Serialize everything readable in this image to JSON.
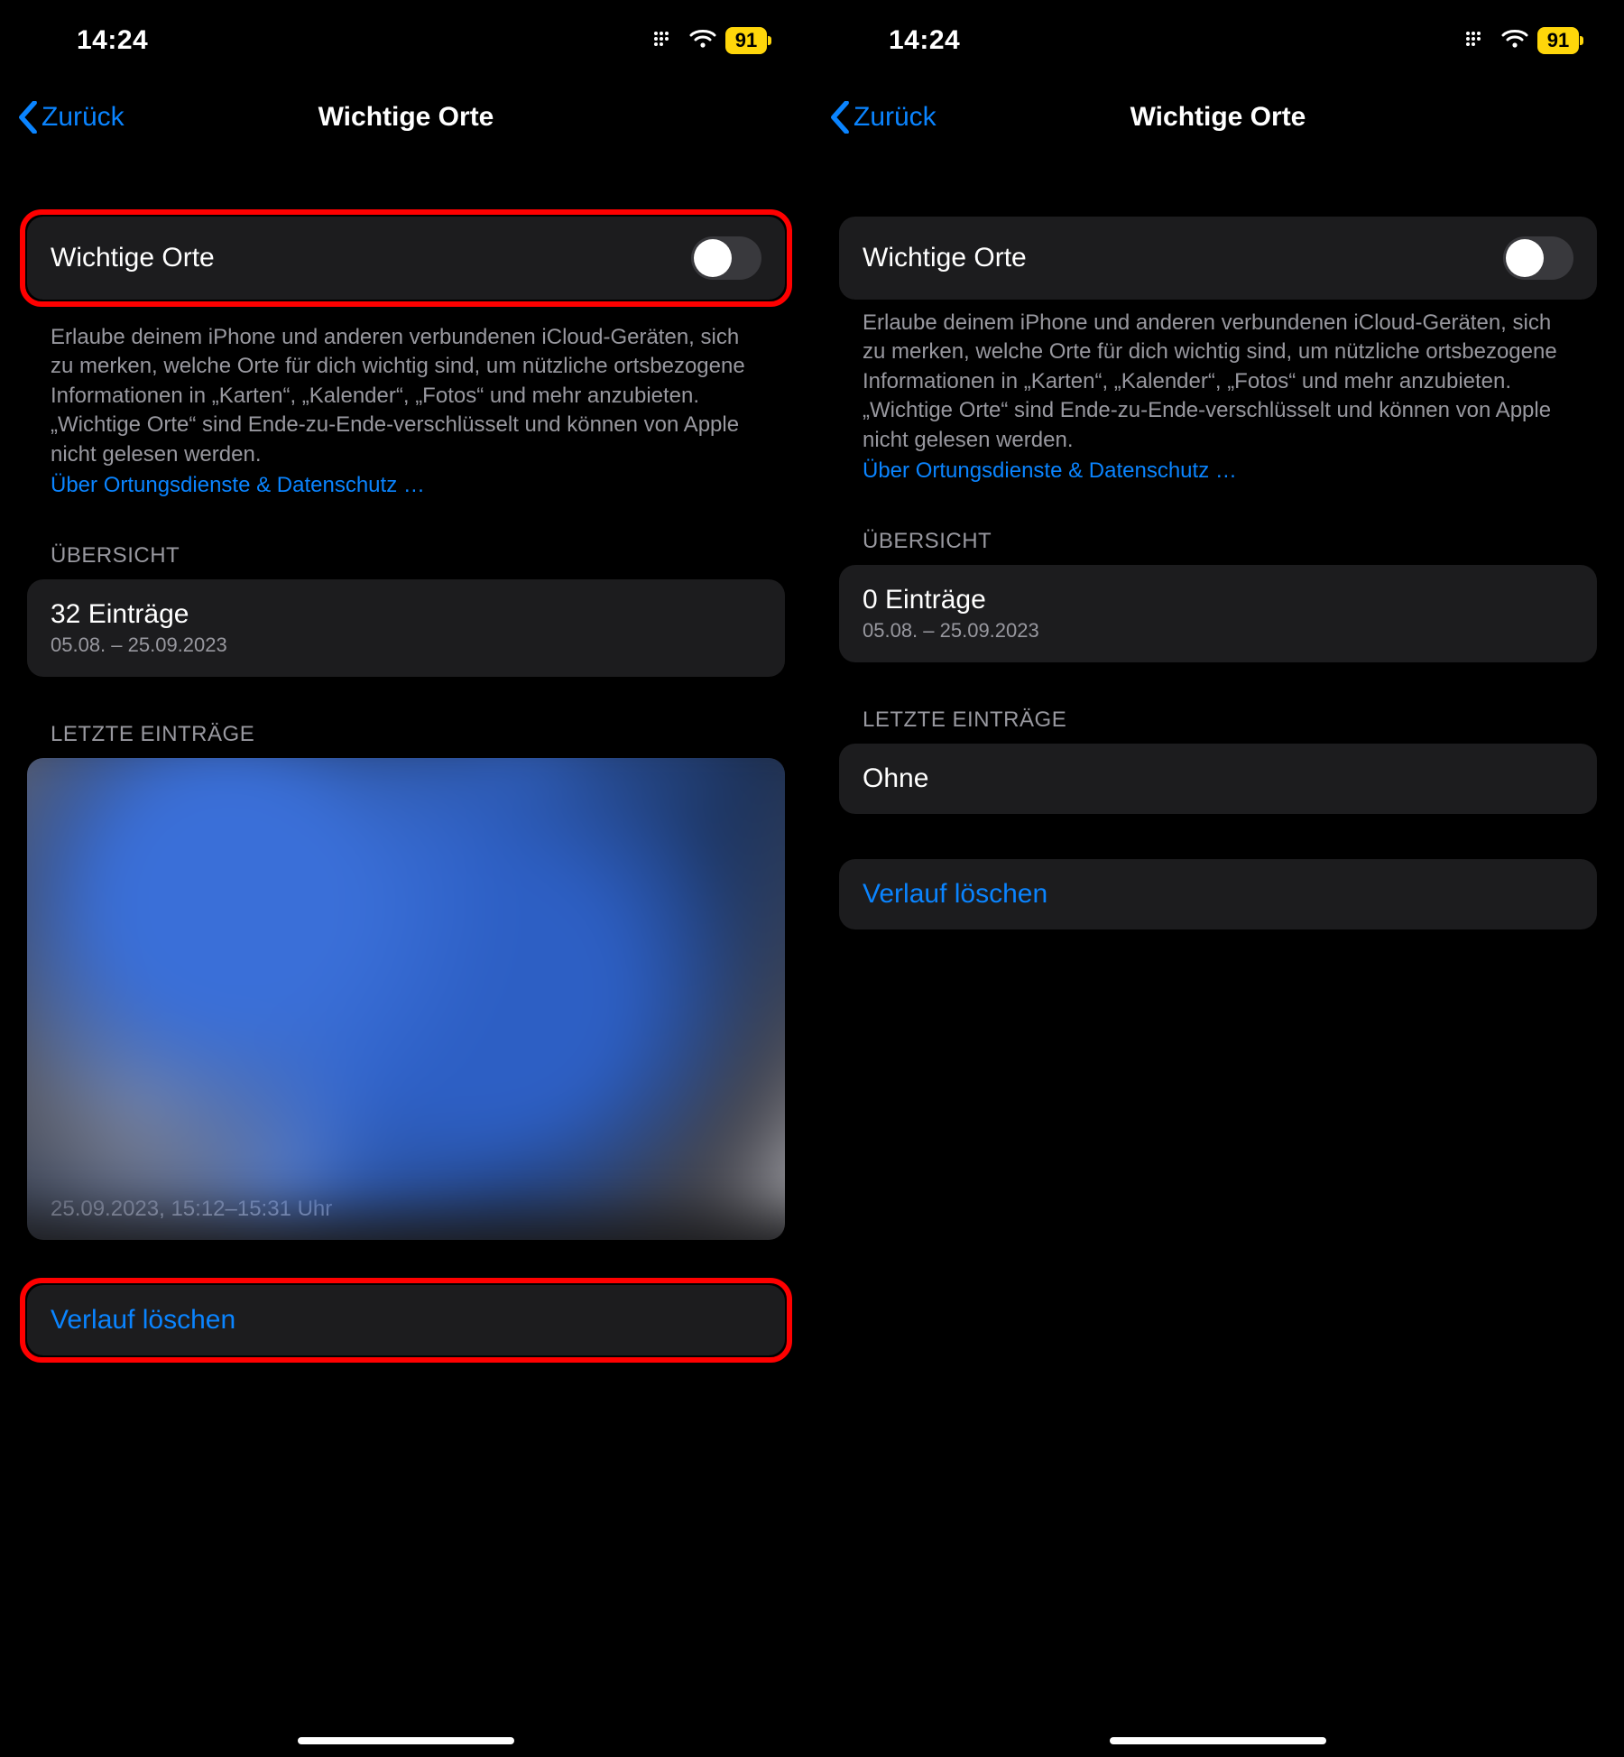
{
  "left": {
    "status": {
      "time": "14:24",
      "battery": "91"
    },
    "nav": {
      "back": "Zurück",
      "title": "Wichtige Orte"
    },
    "toggle_label": "Wichtige Orte",
    "footer_text": "Erlaube deinem iPhone und anderen verbundenen iCloud-Geräten, sich zu merken, welche Orte für dich wichtig sind, um nützliche ortsbezogene Informationen in „Karten“, „Kalender“, „Fotos“ und mehr anzubieten. „Wichtige Orte“ sind Ende-zu-Ende-verschlüsselt und können von Apple nicht gelesen werden.",
    "footer_link": "Über Ortungsdienste & Datenschutz …",
    "overview_header": "ÜBERSICHT",
    "overview_title": "32 Einträge",
    "overview_sub": "05.08. – 25.09.2023",
    "recent_header": "LETZTE EINTRÄGE",
    "recent_caption": "25.09.2023, 15:12–15:31 Uhr",
    "clear": "Verlauf löschen"
  },
  "right": {
    "status": {
      "time": "14:24",
      "battery": "91"
    },
    "nav": {
      "back": "Zurück",
      "title": "Wichtige Orte"
    },
    "toggle_label": "Wichtige Orte",
    "footer_text": "Erlaube deinem iPhone und anderen verbundenen iCloud-Geräten, sich zu merken, welche Orte für dich wichtig sind, um nützliche ortsbezogene Informationen in „Karten“, „Kalender“, „Fotos“ und mehr anzubieten. „Wichtige Orte“ sind Ende-zu-Ende-verschlüsselt und können von Apple nicht gelesen werden.",
    "footer_link": "Über Ortungsdienste & Datenschutz …",
    "overview_header": "ÜBERSICHT",
    "overview_title": "0 Einträge",
    "overview_sub": "05.08. – 25.09.2023",
    "recent_header": "LETZTE EINTRÄGE",
    "recent_none": "Ohne",
    "clear": "Verlauf löschen"
  }
}
